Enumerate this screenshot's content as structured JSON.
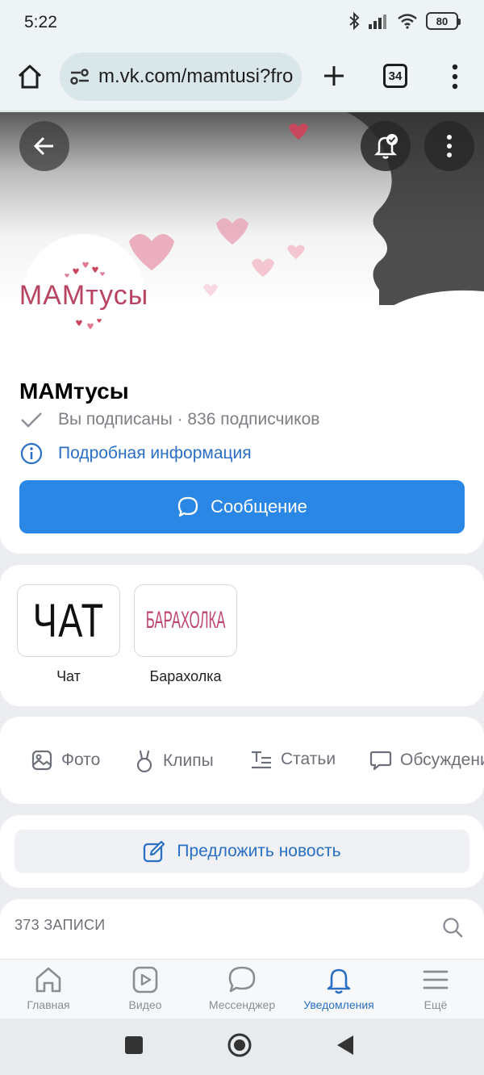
{
  "status_bar": {
    "time": "5:22",
    "battery": "80"
  },
  "browser": {
    "url": "m.vk.com/mamtusi?fro",
    "tab_count": "34"
  },
  "group": {
    "avatar_text": "МАМтусы",
    "name": "МАМтусы",
    "subscription": "Вы подписаны · 836 подписчиков",
    "info_link": "Подробная информация",
    "message_button": "Сообщение"
  },
  "links": [
    {
      "thumb_text": "ЧАТ",
      "label": "Чат"
    },
    {
      "thumb_text": "БАРАХОЛКА",
      "label": "Барахолка"
    }
  ],
  "sections": [
    {
      "label": "Фото",
      "icon": "photo-icon"
    },
    {
      "label": "Клипы",
      "icon": "clips-icon"
    },
    {
      "label": "Статьи",
      "icon": "articles-icon"
    },
    {
      "label": "Обсуждения",
      "icon": "discussions-icon"
    }
  ],
  "suggest_button": "Предложить новость",
  "posts": {
    "count_label": "373 ЗАПИСИ"
  },
  "bottom_nav": [
    {
      "label": "Главная",
      "icon": "home-icon"
    },
    {
      "label": "Видео",
      "icon": "video-icon"
    },
    {
      "label": "Мессенджер",
      "icon": "messenger-icon"
    },
    {
      "label": "Уведомления",
      "icon": "bell-icon"
    },
    {
      "label": "Ещё",
      "icon": "menu-icon"
    }
  ],
  "colors": {
    "accent": "#2b87e6",
    "link": "#2a6fc4",
    "heart": "#e9a6b8",
    "brand_pink": "#b84462"
  }
}
